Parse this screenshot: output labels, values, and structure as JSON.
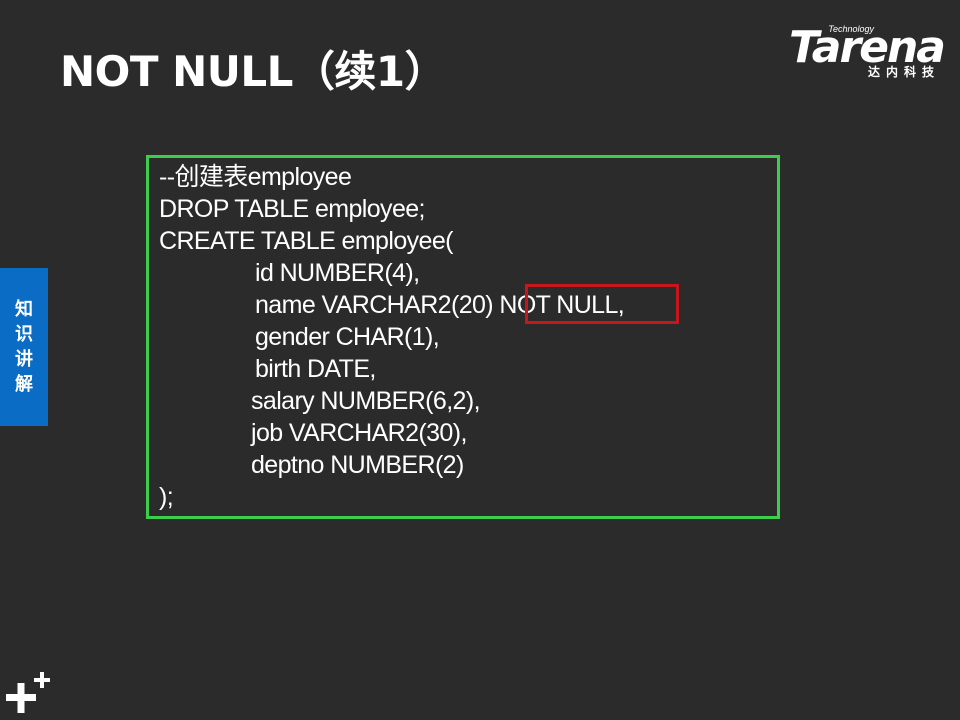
{
  "slide": {
    "title": "NOT NULL（续1）"
  },
  "logo": {
    "tagline": "Technology",
    "wordmark": "Tarena",
    "chinese": "达内科技"
  },
  "side_tab": {
    "chars": [
      "知",
      "识",
      "讲",
      "解"
    ]
  },
  "code": {
    "lines": [
      "--创建表employee",
      "DROP TABLE employee;",
      "CREATE TABLE employee(",
      "id NUMBER(4),",
      "name VARCHAR2(20) NOT NULL,",
      "gender CHAR(1),",
      "birth DATE,",
      "salary NUMBER(6,2),",
      "job VARCHAR2(30),",
      "deptno NUMBER(2)",
      ");"
    ]
  },
  "colors": {
    "background": "#2b2b2b",
    "code_border": "#3ccd4d",
    "highlight_border": "#c8161d",
    "side_tab": "#0a6cc4"
  },
  "icons": [
    "plus-decoration-icon"
  ]
}
